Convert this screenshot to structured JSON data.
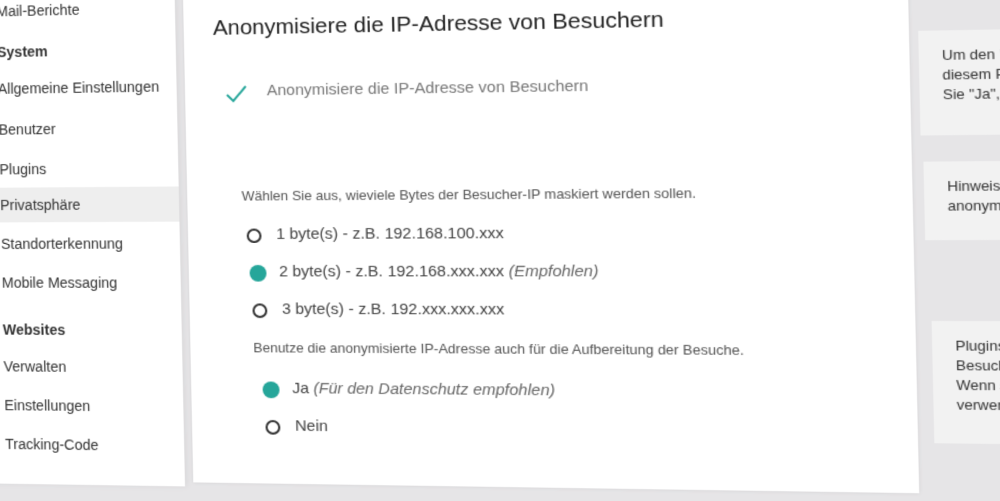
{
  "sidebar": {
    "items": [
      {
        "label": "Mail-Berichte",
        "type": "item"
      },
      {
        "label": "System",
        "type": "heading"
      },
      {
        "label": "Allgemeine Einstellungen",
        "type": "item"
      },
      {
        "label": "Benutzer",
        "type": "item"
      },
      {
        "label": "Plugins",
        "type": "item"
      },
      {
        "label": "Privatsphäre",
        "type": "item",
        "active": true
      },
      {
        "label": "Standorterkennung",
        "type": "item"
      },
      {
        "label": "Mobile Messaging",
        "type": "item"
      },
      {
        "label": "Websites",
        "type": "heading"
      },
      {
        "label": "Verwalten",
        "type": "item"
      },
      {
        "label": "Einstellungen",
        "type": "item"
      },
      {
        "label": "Tracking-Code",
        "type": "item"
      }
    ]
  },
  "main": {
    "title": "Anonymisiere die IP-Adresse von Besuchern",
    "checkbox_label": "Anonymisiere die IP-Adresse von Besuchern",
    "bytes_question": "Wählen Sie aus, wieviele Bytes der Besucher-IP maskiert werden sollen.",
    "bytes_options": [
      {
        "label": "1 byte(s) - z.B. 192.168.100.xxx",
        "note": "",
        "checked": false
      },
      {
        "label": "2 byte(s) - z.B. 192.168.xxx.xxx",
        "note": "(Empfohlen)",
        "checked": true
      },
      {
        "label": "3 byte(s) - z.B. 192.xxx.xxx.xxx",
        "note": "",
        "checked": false
      }
    ],
    "use_question": "Benutze die anonymisierte IP-Adresse auch für die Aufbereitung der Besuche.",
    "use_options": [
      {
        "label": "Ja",
        "note": "(Für den Datenschutz empfohlen)",
        "checked": true
      },
      {
        "label": "Nein",
        "note": "",
        "checked": false
      }
    ]
  },
  "help": {
    "box1": [
      "Um den Datenschutz",
      "diesem Plugin die let",
      "Sie \"Ja\", wenn Mamo"
    ],
    "box2": [
      "Hinweis: Standorte",
      "anonymisiert ist. Be"
    ],
    "box3": [
      "Plugins wie Geolo",
      "Besuchers. Norm",
      "Wenn sie 'Nein' a",
      "verwendet. Darau"
    ]
  },
  "colors": {
    "accent": "#26a69a",
    "background": "#e6e5e7",
    "help_bg": "#f2f2f2"
  },
  "icons": {
    "checkmark": "check-icon"
  }
}
